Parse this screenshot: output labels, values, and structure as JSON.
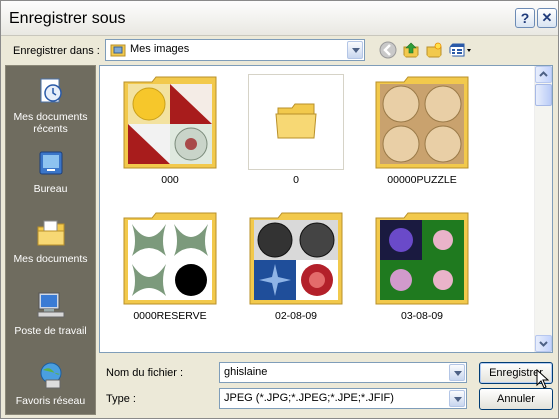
{
  "window": {
    "title": "Enregistrer sous"
  },
  "save_in": {
    "label": "Enregistrer dans :",
    "value": "Mes images"
  },
  "places": [
    {
      "label": "Mes documents récents",
      "icon": "recent-documents-icon"
    },
    {
      "label": "Bureau",
      "icon": "desktop-icon"
    },
    {
      "label": "Mes documents",
      "icon": "my-documents-icon"
    },
    {
      "label": "Poste de travail",
      "icon": "my-computer-icon"
    },
    {
      "label": "Favoris réseau",
      "icon": "network-places-icon"
    }
  ],
  "items": [
    {
      "name": "000"
    },
    {
      "name": "0"
    },
    {
      "name": "00000PUZZLE"
    },
    {
      "name": "0000RESERVE"
    },
    {
      "name": "02-08-09"
    },
    {
      "name": "03-08-09"
    }
  ],
  "filename": {
    "label": "Nom du fichier :",
    "value": "ghislaine"
  },
  "filetype": {
    "label": "Type :",
    "value": "JPEG (*.JPG;*.JPEG;*.JPE;*.JFIF)"
  },
  "buttons": {
    "save": "Enregistrer",
    "cancel": "Annuler"
  },
  "colors": {
    "folder": "#f2c94c",
    "places_bg": "#6f6c5f",
    "titlebar": "#f3f3ee"
  }
}
